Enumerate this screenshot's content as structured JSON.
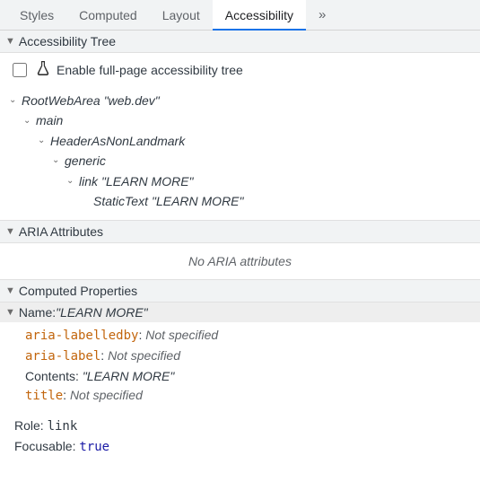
{
  "tabs": {
    "items": [
      "Styles",
      "Computed",
      "Layout",
      "Accessibility"
    ],
    "more": "»",
    "active_index": 3
  },
  "sections": {
    "tree_header": "Accessibility Tree",
    "aria_header": "ARIA Attributes",
    "computed_header": "Computed Properties"
  },
  "enable": {
    "label": "Enable full-page accessibility tree"
  },
  "tree": {
    "n0": {
      "role": "RootWebArea",
      "name": "\"web.dev\""
    },
    "n1": {
      "role": "main"
    },
    "n2": {
      "role": "HeaderAsNonLandmark"
    },
    "n3": {
      "role": "generic"
    },
    "n4": {
      "role": "link",
      "name": "\"LEARN MORE\""
    },
    "n5": {
      "role": "StaticText",
      "name": "\"LEARN MORE\""
    }
  },
  "aria": {
    "empty": "No ARIA attributes"
  },
  "computed": {
    "name_label": "Name: ",
    "name_value": "\"LEARN MORE\"",
    "rows": {
      "labelledby_key": "aria-labelledby",
      "labelledby_val": "Not specified",
      "arialabel_key": "aria-label",
      "arialabel_val": "Not specified",
      "contents_key": "Contents: ",
      "contents_val": "\"LEARN MORE\"",
      "title_key": "title",
      "title_val": "Not specified"
    },
    "role_label": "Role: ",
    "role_value": "link",
    "focusable_label": "Focusable: ",
    "focusable_value": "true"
  }
}
